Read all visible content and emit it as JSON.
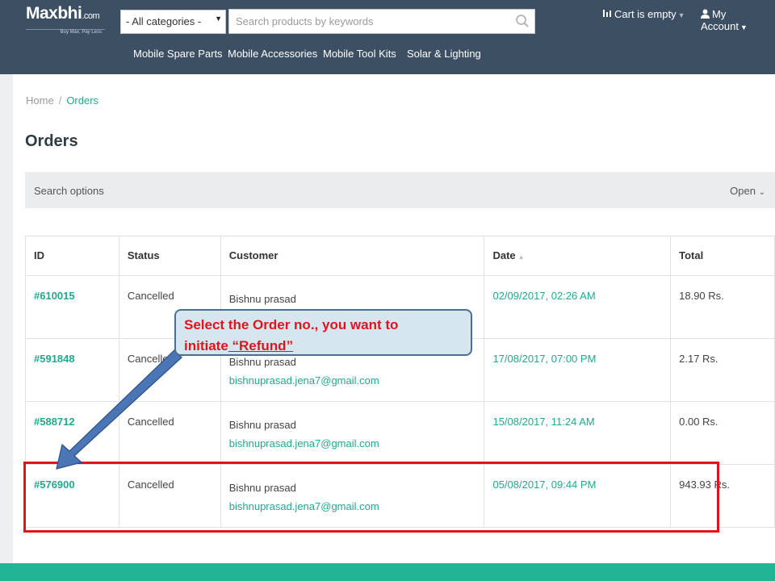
{
  "header": {
    "logo": {
      "name": "Maxbhi",
      "suffix": ".com",
      "tagline": "Buy Max, Pay Less"
    },
    "category_select": "- All categories -",
    "search_placeholder": "Search products by keywords",
    "cart_label": "Cart is empty",
    "account_label": "My Account",
    "nav": [
      "Mobile Spare Parts",
      "Mobile Accessories",
      "Mobile Tool Kits",
      "Solar & Lighting"
    ]
  },
  "breadcrumb": {
    "home": "Home",
    "separator": "/",
    "current": "Orders"
  },
  "page_title": "Orders",
  "search_options": {
    "label": "Search options",
    "toggle": "Open"
  },
  "table": {
    "headers": {
      "id": "ID",
      "status": "Status",
      "customer": "Customer",
      "date": "Date",
      "total": "Total"
    },
    "rows": [
      {
        "id": "#610015",
        "status": "Cancelled",
        "customer": "Bishnu prasad",
        "email": "",
        "date": "02/09/2017, 02:26 AM",
        "total": "18.90 Rs."
      },
      {
        "id": "#591848",
        "status": "Cancelled",
        "customer": "Bishnu prasad",
        "email": "bishnuprasad.jena7@gmail.com",
        "date": "17/08/2017, 07:00 PM",
        "total": "2.17 Rs."
      },
      {
        "id": "#588712",
        "status": "Cancelled",
        "customer": "Bishnu prasad",
        "email": "bishnuprasad.jena7@gmail.com",
        "date": "15/08/2017, 11:24 AM",
        "total": "0.00 Rs."
      },
      {
        "id": "#576900",
        "status": "Cancelled",
        "customer": "Bishnu prasad",
        "email": "bishnuprasad.jena7@gmail.com",
        "date": "05/08/2017, 09:44 PM",
        "total": "943.93 Rs."
      }
    ]
  },
  "callout": {
    "line1": "Select the Order no., you want to",
    "line2_prefix": "initiate",
    "line2_emphasis": " “Refund”"
  },
  "colors": {
    "header_bg": "#3d4f63",
    "accent": "#21a88e",
    "highlight": "#e0141c",
    "callout_bg": "#d6e6ef",
    "footer": "#21b595"
  }
}
